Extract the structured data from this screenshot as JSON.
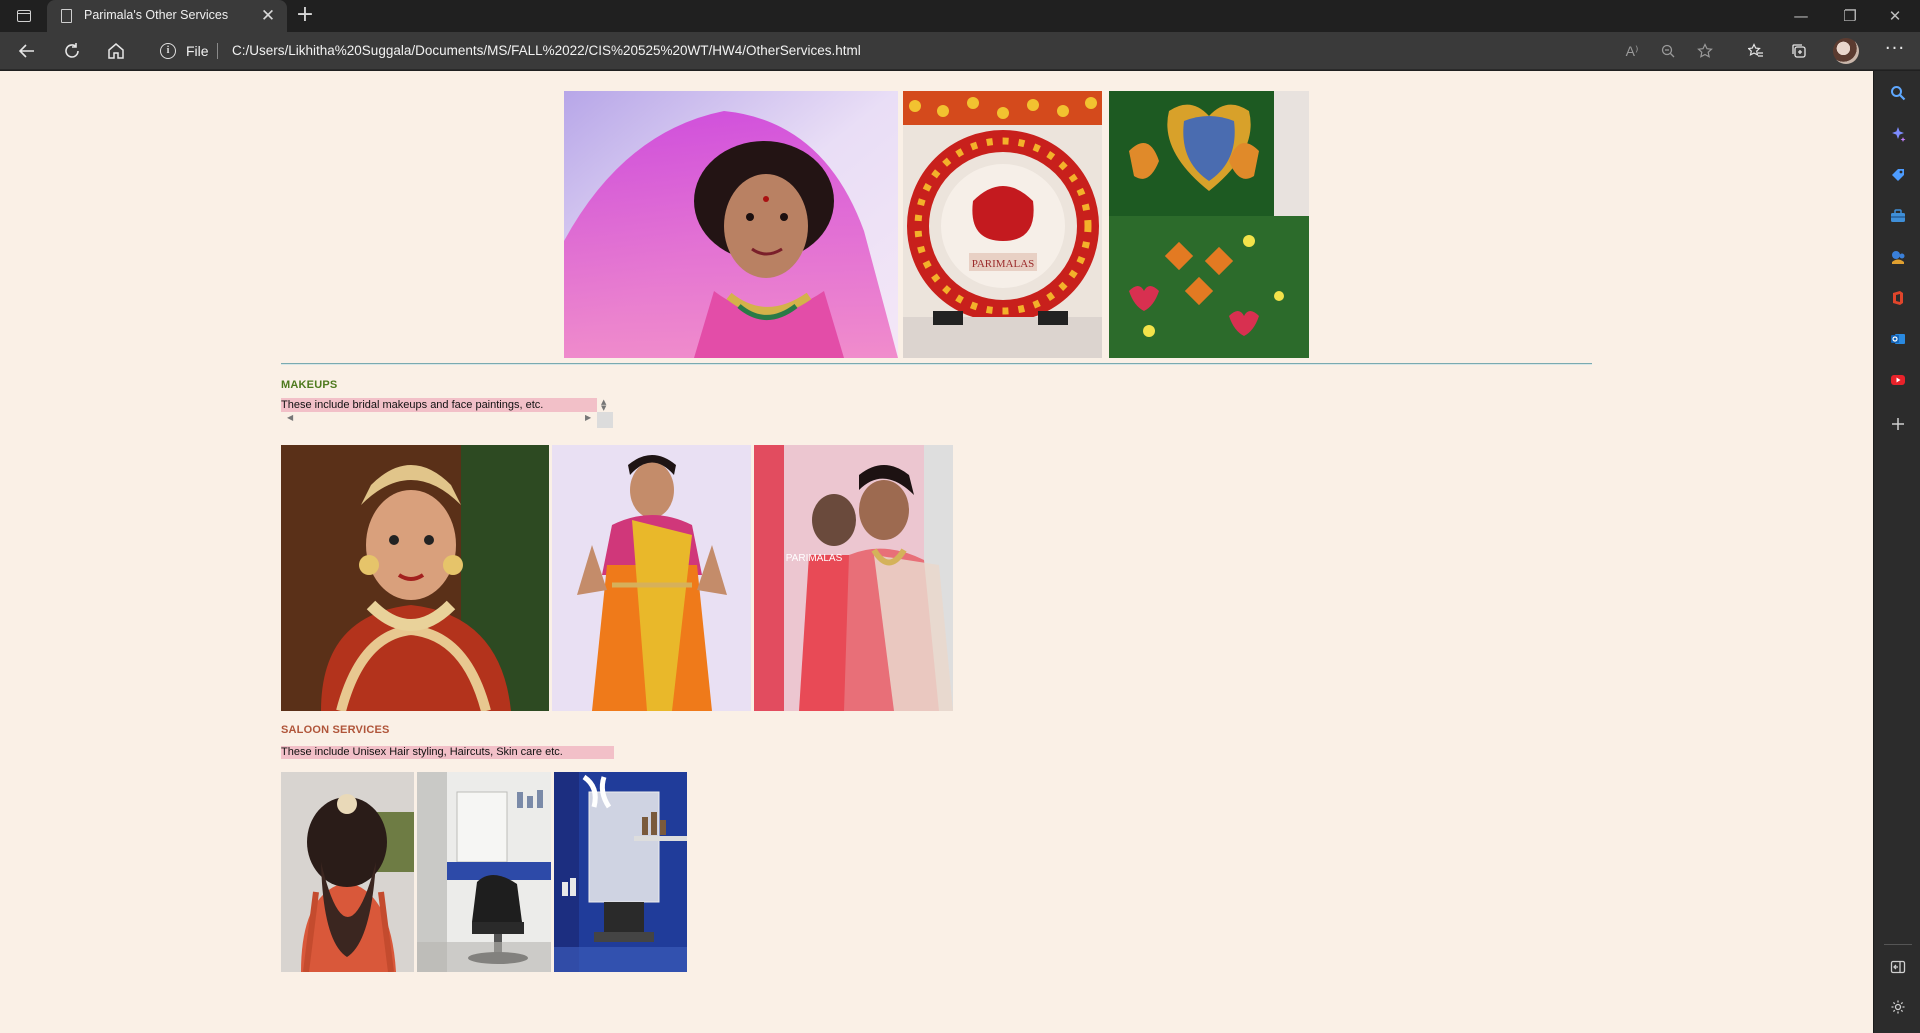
{
  "browser": {
    "tab_title": "Parimala's Other Services",
    "close_glyph": "✕",
    "new_tab_glyph": "+",
    "address_scheme": "File",
    "url": "C:/Users/Likhitha%20Suggala/Documents/MS/FALL%2022/CIS%20525%20WT/HW4/OtherServices.html",
    "read_aloud_glyph": "A⁾",
    "window_controls": [
      "—",
      "❐",
      "✕"
    ],
    "more_glyph": "···"
  },
  "page": {
    "hero_images": [
      {
        "name": "bridal-portrait-photo"
      },
      {
        "name": "floral-ring-decor-photo",
        "caption": "PARIMALAS"
      },
      {
        "name": "floral-rangoli-decor-photo"
      }
    ],
    "makeups": {
      "title": "MAKEUPS",
      "description": "These include bridal makeups and face paintings, etc.",
      "images": [
        {
          "name": "bridal-makeup-photo-1"
        },
        {
          "name": "saree-makeup-photo-2"
        },
        {
          "name": "mirror-makeup-photo-3",
          "watermark": "PARIMALAS"
        }
      ]
    },
    "saloon": {
      "title": "SALOON SERVICES",
      "description": "These include Unisex Hair styling, Haircuts, Skin care etc.",
      "images": [
        {
          "name": "hair-styling-photo"
        },
        {
          "name": "salon-chair-photo"
        },
        {
          "name": "salon-mirror-photo"
        }
      ]
    }
  },
  "sidebar": {
    "icons": [
      "search-icon",
      "copilot-icon",
      "shopping-tag-icon",
      "toolbox-icon",
      "games-icon",
      "office-icon",
      "outlook-icon",
      "youtube-icon",
      "add-icon",
      "split-screen-icon",
      "settings-icon"
    ]
  },
  "colors": {
    "page_background": "#faf0e6",
    "makeups_title": "#4e7a1e",
    "saloon_title": "#b0553a",
    "marquee_background": "#f2c0c8",
    "rule": "#7aaab0"
  }
}
